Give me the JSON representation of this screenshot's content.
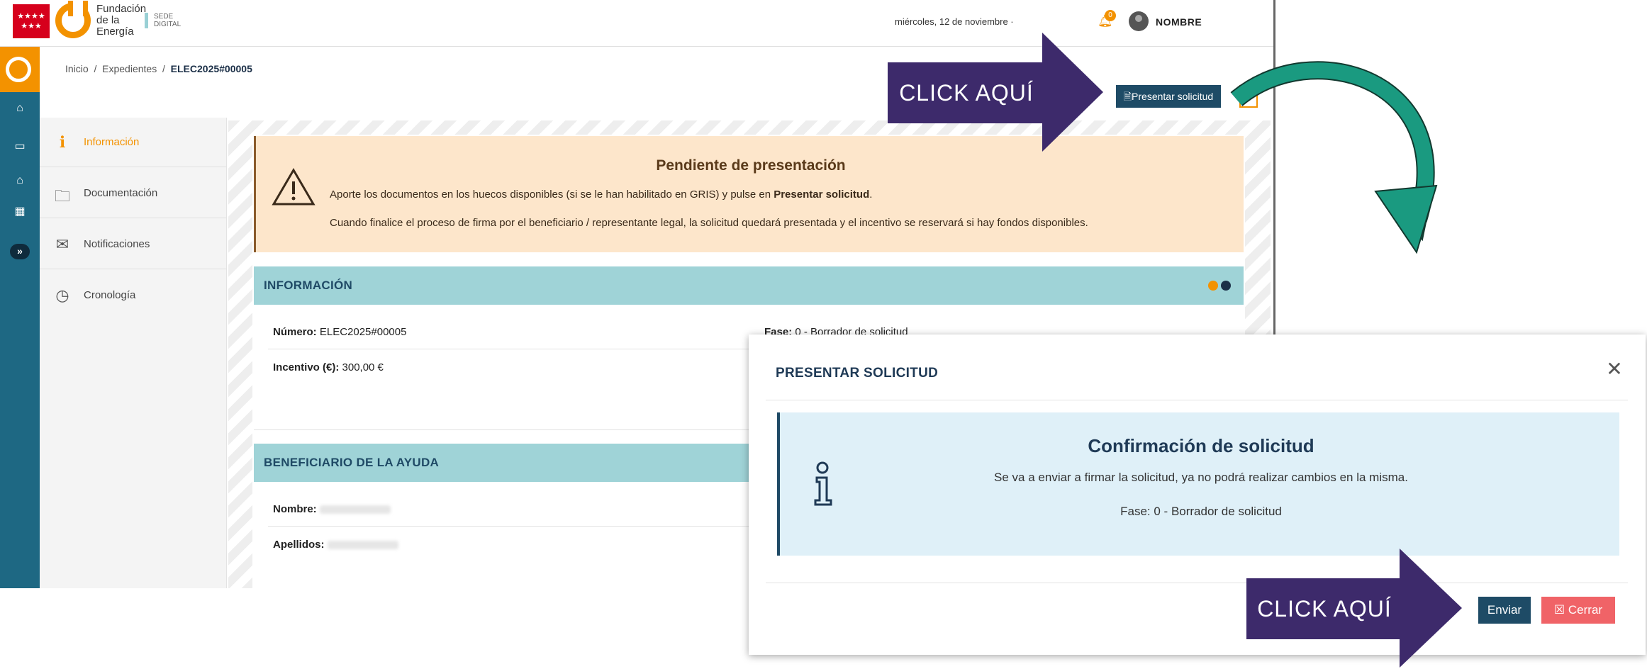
{
  "header": {
    "brand_line1": "Fundación",
    "brand_line2": "de la",
    "brand_line3": "Energía",
    "sede_line1": "SEDE",
    "sede_line2": "DIGITAL",
    "date": "miércoles, 12 de noviembre ·",
    "notifications_count": "0",
    "username": "NOMBRE"
  },
  "breadcrumb": {
    "home": "Inicio",
    "sep": "/",
    "section": "Expedientes",
    "current": "ELEC2025#00005"
  },
  "toolbar": {
    "presentar_label": "Presentar solicitud"
  },
  "submenu": [
    {
      "label": "Información",
      "icon": "info-icon"
    },
    {
      "label": "Documentación",
      "icon": "folder-icon"
    },
    {
      "label": "Notificaciones",
      "icon": "envelope-icon"
    },
    {
      "label": "Cronología",
      "icon": "clock-icon"
    }
  ],
  "warning": {
    "title": "Pendiente de presentación",
    "line1_prefix": "Aporte los documentos en los huecos disponibles (si se le han habilitado en GRIS) y pulse en ",
    "line1_bold": "Presentar solicitud",
    "line1_suffix": ".",
    "line2": "Cuando finalice el proceso de firma por el beneficiario / representante legal, la solicitud quedará presentada y el incentivo se reservará si hay fondos disponibles."
  },
  "info_panel": {
    "title": "INFORMACIÓN",
    "numero_label": "Número:",
    "numero_value": "ELEC2025#00005",
    "fase_label": "Fase:",
    "fase_value": "0 - Borrador de solicitud",
    "incentivo_label": "Incentivo (€):",
    "incentivo_value": "300,00 €"
  },
  "beneficiario_panel": {
    "title": "BENEFICIARIO DE LA AYUDA",
    "nombre_label": "Nombre:",
    "apellidos_label": "Apellidos:"
  },
  "callouts": {
    "top": "CLICK AQUÍ",
    "bottom": "CLICK AQUÍ"
  },
  "modal": {
    "title": "PRESENTAR SOLICITUD",
    "confirm_title": "Confirmación de solicitud",
    "confirm_line1": "Se va a enviar a firmar la solicitud, ya no podrá realizar cambios en la misma.",
    "confirm_line2": "Fase: 0 - Borrador de solicitud",
    "enviar_label": "Enviar",
    "cerrar_label": "Cerrar"
  },
  "colors": {
    "accent_orange": "#f39200",
    "navy": "#1e4b66",
    "teal_header": "#9fd3d7",
    "callout_purple": "#3d2a6b",
    "arrow_green": "#1a9a80",
    "cerrar_red": "#f06367"
  }
}
